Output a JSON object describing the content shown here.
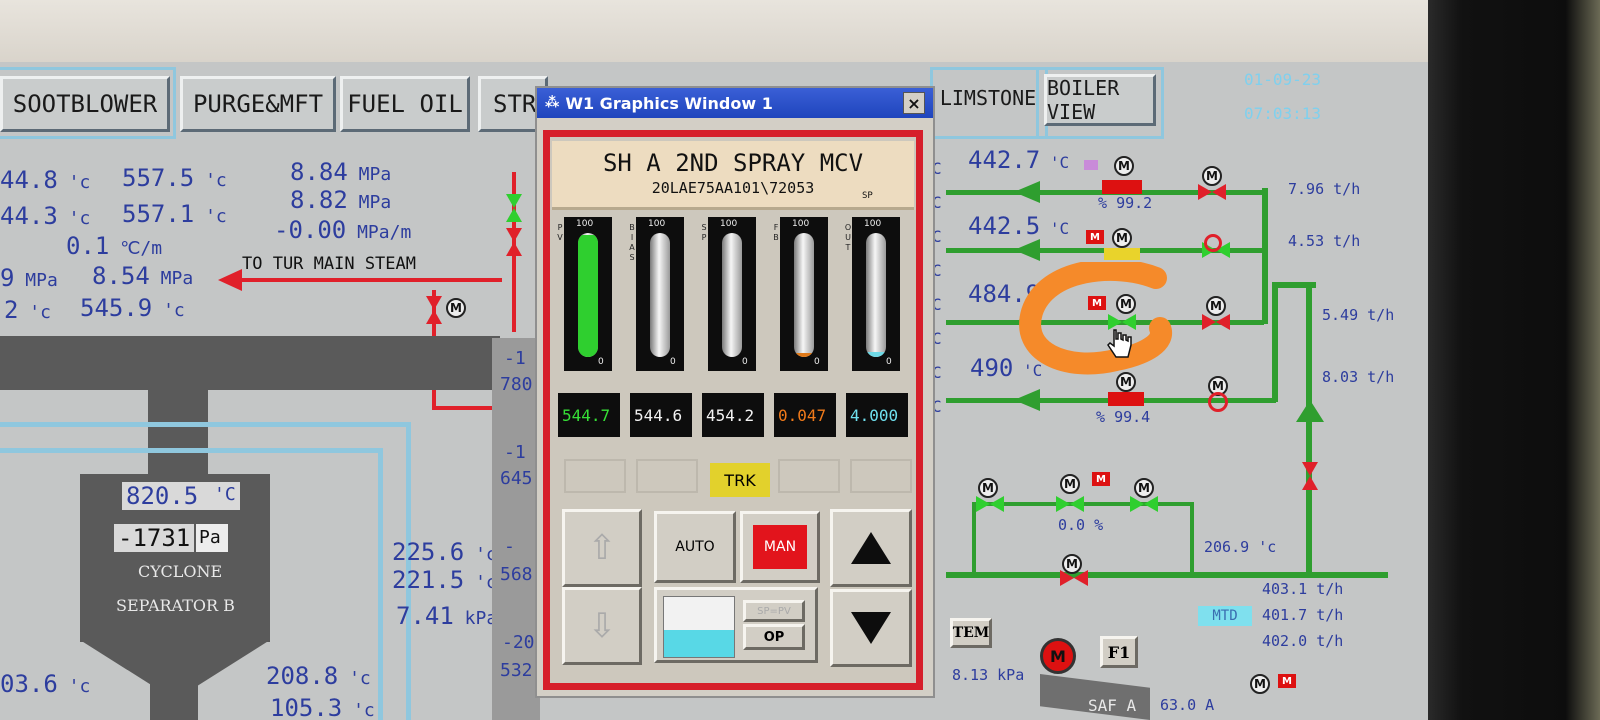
{
  "clock": {
    "date": "01-09-23",
    "time": "07:03:13"
  },
  "nav": {
    "sootblower": "SOOTBLOWER",
    "purge": "PURGE&MFT",
    "fuel_oil": "FUEL OIL",
    "str": "STR",
    "limstone": "LIMSTONE",
    "boiler_view": "BOILER VIEW"
  },
  "left": {
    "t1a": "44.8",
    "t1b": "557.5",
    "t2a": "44.3",
    "t2b": "557.1",
    "rate": "0.1",
    "p1": "8.84",
    "p2": "8.82",
    "pr": "-0.00",
    "p3a": "9",
    "p3b": "8.54",
    "t4a": "2",
    "t4b": "545.9",
    "label_main_steam": "TO TUR MAIN STEAM",
    "unit_c": "'c",
    "unit_mpa": "MPa",
    "unit_mpam": "MPa/m",
    "unit_cm": "℃/m"
  },
  "cyclone": {
    "temp": "820.5",
    "temp_unit": "'C",
    "press": "-1731",
    "press_unit": "Pa",
    "line1": "CYCLONE",
    "line2": "SEPARATOR B",
    "t_a": "225.6",
    "t_b": "221.5",
    "kpa": "7.41",
    "kpa_unit": "kPa",
    "t_c": "208.8",
    "t_d": "105.3",
    "t_e": "03.6",
    "unit_c": "'C"
  },
  "mid_partial": [
    "-1",
    "780",
    "-1",
    "645",
    "-",
    "568",
    "-20",
    "532"
  ],
  "right": {
    "t1": "442.7",
    "t2": "442.5",
    "t3": "484.9",
    "t4": "490",
    "unit_c": "'C",
    "pct1": "99.2",
    "pct2": "99.4",
    "pct_sign": "%",
    "f1": "7.96",
    "f2": "4.53",
    "f3": "5.49",
    "f4": "8.03",
    "unit_th": "t/h",
    "valve_pct": "0.0",
    "t5": "206.9",
    "t5_unit": "'c",
    "f5": "403.1",
    "f6": "401.7",
    "f7": "402.0",
    "mtd": "MTD",
    "tem": "TEM",
    "f1_btn": "F1",
    "m_btn": "M",
    "kpa": "8.13",
    "kpa_unit": "kPa",
    "saf": "SAF A",
    "amp": "63.0 A",
    "c_marks": "C"
  },
  "dialog": {
    "title": "W1 Graphics Window 1",
    "close": "×",
    "name": "SH A 2ND SPRAY MCV",
    "tag": "20LAE75AA101\\72053",
    "sp_label": "SP",
    "bars": [
      {
        "side": "P V",
        "max": "100",
        "min": "0",
        "fill": 0.98,
        "color": "#2fcf2f"
      },
      {
        "side": "B I A S",
        "max": "100",
        "min": "0",
        "fill": 0.0,
        "color": "#999"
      },
      {
        "side": "S P",
        "max": "100",
        "min": "0",
        "fill": 0.0,
        "color": "#999"
      },
      {
        "side": "F B",
        "max": "100",
        "min": "0",
        "fill": 0.03,
        "color": "#e07a1a"
      },
      {
        "side": "O U T",
        "max": "100",
        "min": "0",
        "fill": 0.04,
        "color": "#6fd9e6"
      }
    ],
    "readouts": [
      {
        "value": "544.7",
        "color": "#36e036"
      },
      {
        "value": "544.6",
        "color": "#f2f2f2"
      },
      {
        "value": "454.2",
        "color": "#f2f2f2"
      },
      {
        "value": "0.047",
        "color": "#f07a1a"
      },
      {
        "value": "4.000",
        "color": "#6fe0ee"
      }
    ],
    "trk": "TRK",
    "auto": "AUTO",
    "man": "MAN",
    "sp_pv": "SP=PV",
    "op": "OP",
    "op_level": 0.45
  }
}
